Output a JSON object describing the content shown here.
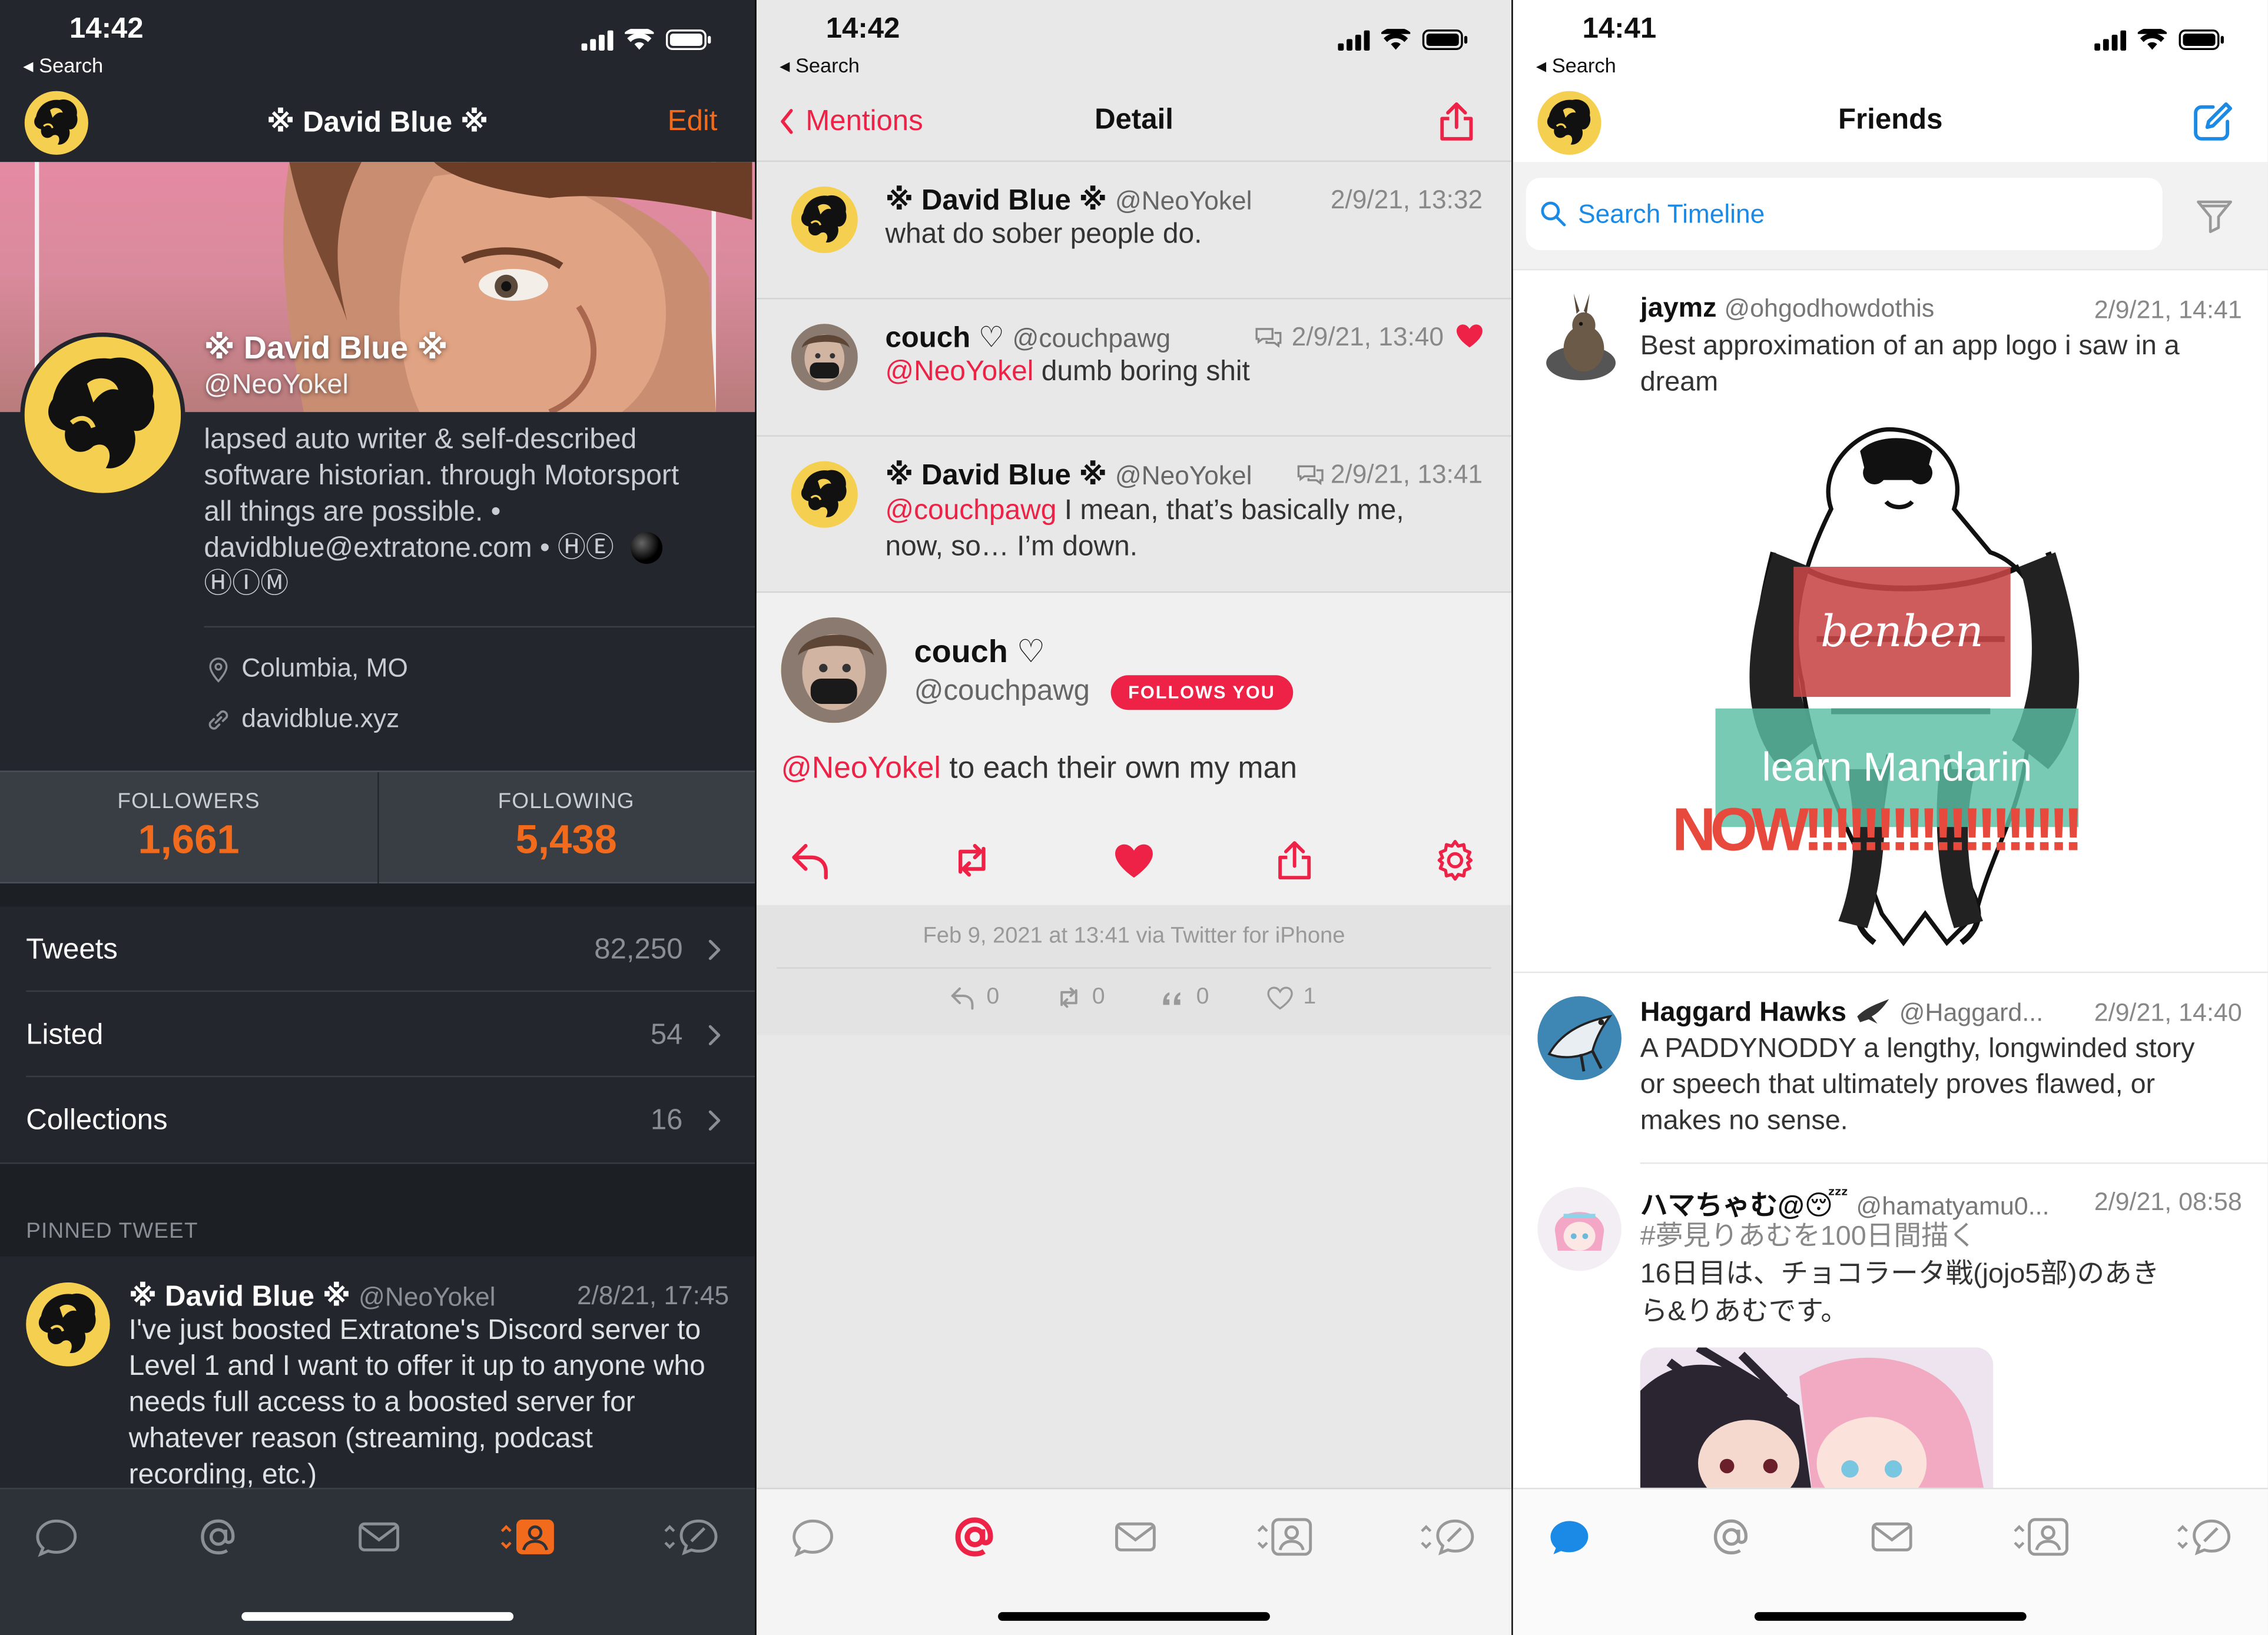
{
  "colors": {
    "accent_dark": "#f26a1b",
    "accent_red": "#ee2246",
    "accent_blue": "#1a8ae6",
    "avatar_yellow": "#f5cf4f"
  },
  "p1": {
    "time": "14:42",
    "back": "Search",
    "nav_title": "※ David Blue ※",
    "edit": "Edit",
    "profile": {
      "name": "※ David Blue ※",
      "handle": "@NeoYokel",
      "bio": [
        "lapsed auto writer & self-described",
        "software historian. through Motorsport",
        "all things are possible. •",
        "davidblue@extratone.com • ⒽⒺ"
      ],
      "bio_tail": "ⒽⒾⓂ",
      "location": "Columbia, MO",
      "url": "davidblue.xyz"
    },
    "followers_label": "FOLLOWERS",
    "followers": "1,661",
    "following_label": "FOLLOWING",
    "following": "5,438",
    "rows": [
      {
        "label": "Tweets",
        "value": "82,250"
      },
      {
        "label": "Listed",
        "value": "54"
      },
      {
        "label": "Collections",
        "value": "16"
      }
    ],
    "pinned_label": "PINNED TWEET",
    "pinned": {
      "name": "※ David Blue ※",
      "handle": "@NeoYokel",
      "time": "2/8/21, 17:45",
      "text": [
        "I've just boosted Extratone's Discord server to",
        "Level 1 and I want to offer it up to anyone who",
        "needs full access to a boosted server for",
        "whatever reason (streaming, podcast",
        "recording, etc.)"
      ]
    }
  },
  "p2": {
    "time": "14:42",
    "back": "Search",
    "back_label": "Mentions",
    "nav_title": "Detail",
    "tweets": [
      {
        "name": "※ David Blue ※",
        "handle": "@NeoYokel",
        "time": "2/9/21, 13:32",
        "mention": "",
        "text": "what do sober people do."
      },
      {
        "name": "couch ♡",
        "handle": "@couchpawg",
        "time": "2/9/21, 13:40",
        "mention": "@NeoYokel",
        "text": " dumb boring shit"
      },
      {
        "name": "※ David Blue ※",
        "handle": "@NeoYokel",
        "time": "2/9/21, 13:41",
        "mention": "@couchpawg",
        "text": " I mean, that’s basically me,",
        "text2": "now, so… I’m down."
      }
    ],
    "detail": {
      "name": "couch ♡",
      "handle": "@couchpawg",
      "badge": "FOLLOWS YOU",
      "mention": "@NeoYokel",
      "text": " to each their own my man",
      "meta": "Feb 9, 2021 at 13:41 via Twitter for iPhone",
      "counts": {
        "replies": "0",
        "retweets": "0",
        "quotes": "0",
        "likes": "1"
      }
    }
  },
  "p3": {
    "time": "14:41",
    "back": "Search",
    "nav_title": "Friends",
    "search_placeholder": "Search Timeline",
    "tweets": [
      {
        "name": "jaymz",
        "handle": "@ohgodhowdothis",
        "time": "2/9/21, 14:41",
        "text": [
          "Best approximation of an app logo i saw in a",
          "dream"
        ]
      },
      {
        "name": "Haggard Hawks",
        "handle": "@Haggard...",
        "time": "2/9/21, 14:40",
        "text": [
          "A PADDYNODDY a lengthy, longwinded story",
          "or speech that ultimately proves flawed, or",
          "makes no sense."
        ]
      },
      {
        "name": "ハマちゃむ@😴",
        "handle": "@hamatyamu0...",
        "time": "2/9/21, 08:58",
        "hashtag": "#夢見りあむを100日間描く",
        "text": [
          "16日目は、チョコラータ戦(jojo5部)のあき",
          "ら&りあむです。"
        ]
      }
    ],
    "image_text": {
      "benben": "benben",
      "learn": "learn Mandarin",
      "now": "NOW!!!!!!!!!!!!!!!!!!!"
    }
  }
}
